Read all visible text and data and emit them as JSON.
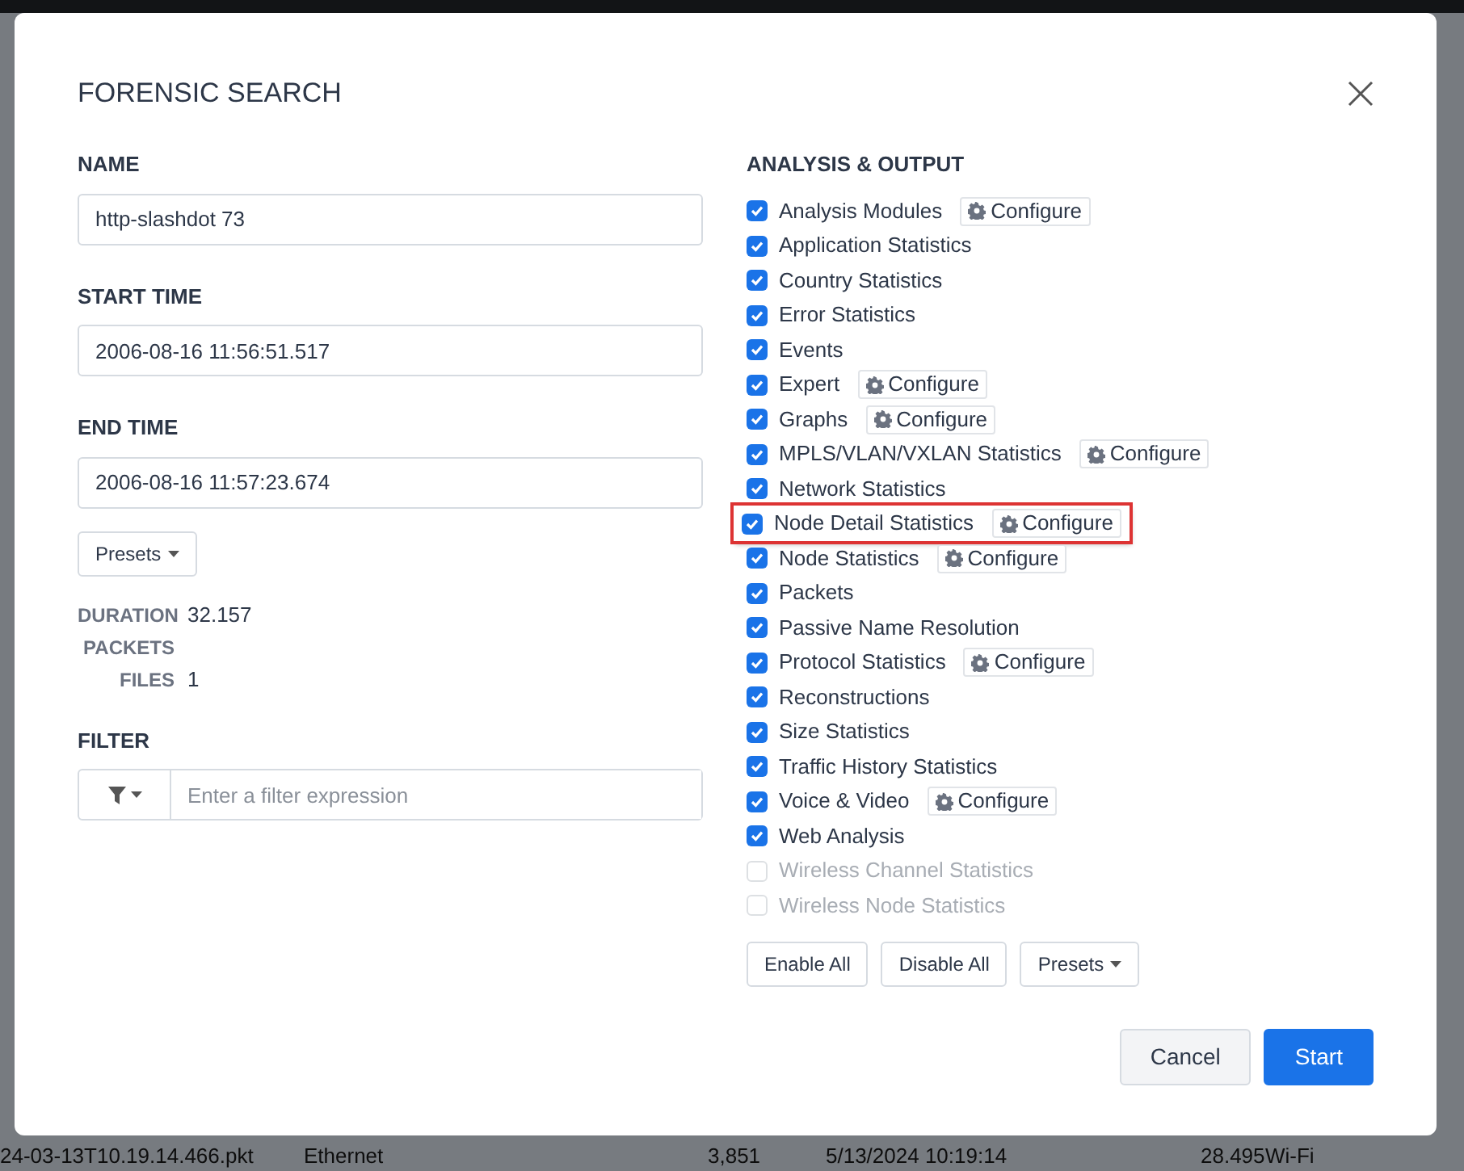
{
  "background_row": [
    "24-03-13T10.19.14.466.pkt",
    "Ethernet",
    "3,851",
    "5/13/2024 10:19:14",
    "28.495",
    "Wi-Fi"
  ],
  "dialog": {
    "title": "FORENSIC SEARCH",
    "name": {
      "label": "NAME",
      "value": "http-slashdot 73"
    },
    "start_time": {
      "label": "START TIME",
      "value": "2006-08-16 11:56:51.517"
    },
    "end_time": {
      "label": "END TIME",
      "value": "2006-08-16 11:57:23.674"
    },
    "presets_button": "Presets",
    "stats": [
      {
        "label": "DURATION",
        "value": "32.157"
      },
      {
        "label": "PACKETS"
      },
      {
        "label": "FILES",
        "value": "1"
      }
    ],
    "filter": {
      "label": "FILTER",
      "placeholder": "Enter a filter expression"
    },
    "analysis": {
      "label": "ANALYSIS & OUTPUT",
      "options": [
        {
          "label": "Analysis Modules",
          "checked": true,
          "disabled": false,
          "configure": "Configure",
          "highlighted": false
        },
        {
          "label": "Application Statistics",
          "checked": true,
          "disabled": false,
          "highlighted": false
        },
        {
          "label": "Country Statistics",
          "checked": true,
          "disabled": false,
          "highlighted": false
        },
        {
          "label": "Error Statistics",
          "checked": true,
          "disabled": false,
          "highlighted": false
        },
        {
          "label": "Events",
          "checked": true,
          "disabled": false,
          "highlighted": false
        },
        {
          "label": "Expert",
          "checked": true,
          "disabled": false,
          "configure": "Configure",
          "highlighted": false
        },
        {
          "label": "Graphs",
          "checked": true,
          "disabled": false,
          "configure": "Configure",
          "highlighted": false
        },
        {
          "label": "MPLS/VLAN/VXLAN Statistics",
          "checked": true,
          "disabled": false,
          "configure": "Configure",
          "highlighted": false
        },
        {
          "label": "Network Statistics",
          "checked": true,
          "disabled": false,
          "highlighted": false
        },
        {
          "label": "Node Detail Statistics",
          "checked": true,
          "disabled": false,
          "configure": "Configure",
          "highlighted": true
        },
        {
          "label": "Node Statistics",
          "checked": true,
          "disabled": false,
          "configure": "Configure",
          "highlighted": false
        },
        {
          "label": "Packets",
          "checked": true,
          "disabled": false,
          "highlighted": false
        },
        {
          "label": "Passive Name Resolution",
          "checked": true,
          "disabled": false,
          "highlighted": false
        },
        {
          "label": "Protocol Statistics",
          "checked": true,
          "disabled": false,
          "configure": "Configure",
          "highlighted": false
        },
        {
          "label": "Reconstructions",
          "checked": true,
          "disabled": false,
          "highlighted": false
        },
        {
          "label": "Size Statistics",
          "checked": true,
          "disabled": false,
          "highlighted": false
        },
        {
          "label": "Traffic History Statistics",
          "checked": true,
          "disabled": false,
          "highlighted": false
        },
        {
          "label": "Voice & Video",
          "checked": true,
          "disabled": false,
          "configure": "Configure",
          "highlighted": false
        },
        {
          "label": "Web Analysis",
          "checked": true,
          "disabled": false,
          "highlighted": false
        },
        {
          "label": "Wireless Channel Statistics",
          "checked": false,
          "disabled": true,
          "highlighted": false
        },
        {
          "label": "Wireless Node Statistics",
          "checked": false,
          "disabled": true,
          "highlighted": false
        }
      ],
      "buttons": [
        "Enable All",
        "Disable All"
      ],
      "presets_button": "Presets"
    },
    "footer_buttons": [
      {
        "label": "Cancel",
        "kind": "secondary"
      },
      {
        "label": "Start",
        "kind": "primary"
      }
    ]
  }
}
